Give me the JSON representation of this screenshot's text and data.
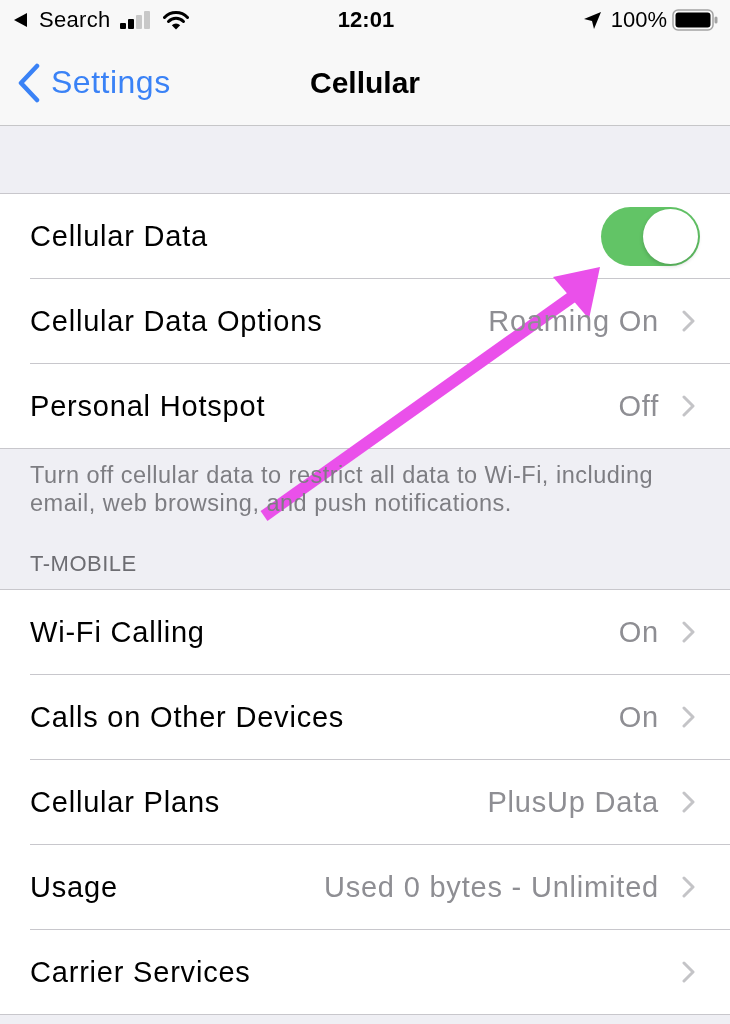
{
  "status_bar": {
    "back_app": "Search",
    "time": "12:01",
    "battery_percent": "100%"
  },
  "nav": {
    "back": "Settings",
    "title": "Cellular"
  },
  "groups": [
    {
      "rows": [
        {
          "kind": "toggle",
          "label": "Cellular Data",
          "on": true
        },
        {
          "kind": "link",
          "label": "Cellular Data Options",
          "value": "Roaming On"
        },
        {
          "kind": "link",
          "label": "Personal Hotspot",
          "value": "Off"
        }
      ],
      "footer": "Turn off cellular data to restrict all data to Wi-Fi, including email, web browsing, and push notifications."
    },
    {
      "header": "T-MOBILE",
      "rows": [
        {
          "kind": "link",
          "label": "Wi-Fi Calling",
          "value": "On"
        },
        {
          "kind": "link",
          "label": "Calls on Other Devices",
          "value": "On"
        },
        {
          "kind": "link",
          "label": "Cellular Plans",
          "value": "PlusUp Data"
        },
        {
          "kind": "link",
          "label": "Usage",
          "value": "Used 0 bytes - Unlimited"
        },
        {
          "kind": "link",
          "label": "Carrier Services"
        }
      ]
    }
  ]
}
